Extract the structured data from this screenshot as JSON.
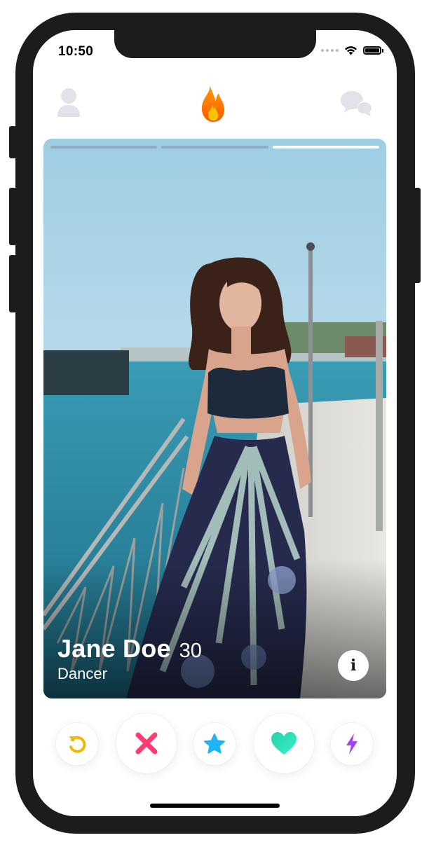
{
  "status_bar": {
    "time": "10:50"
  },
  "top_nav": {
    "profile_icon": "profile-icon",
    "logo_icon": "flame-icon",
    "messages_icon": "chat-bubbles-icon",
    "logo_colors": [
      "#ff6a00",
      "#ffc400"
    ]
  },
  "card": {
    "name": "Jane Doe",
    "age": "30",
    "occupation": "Dancer",
    "photo_count": 3,
    "active_photo": 3,
    "info_label": "i"
  },
  "actions": [
    {
      "name": "rewind",
      "icon": "rewind-icon",
      "color": "#f5b800"
    },
    {
      "name": "nope",
      "icon": "x-icon",
      "color": "#fe3c72"
    },
    {
      "name": "super-like",
      "icon": "star-icon",
      "color": "#1db5f5"
    },
    {
      "name": "like",
      "icon": "heart-icon",
      "color": "#2be3bd"
    },
    {
      "name": "boost",
      "icon": "lightning-icon",
      "color": "#a643f1"
    }
  ]
}
